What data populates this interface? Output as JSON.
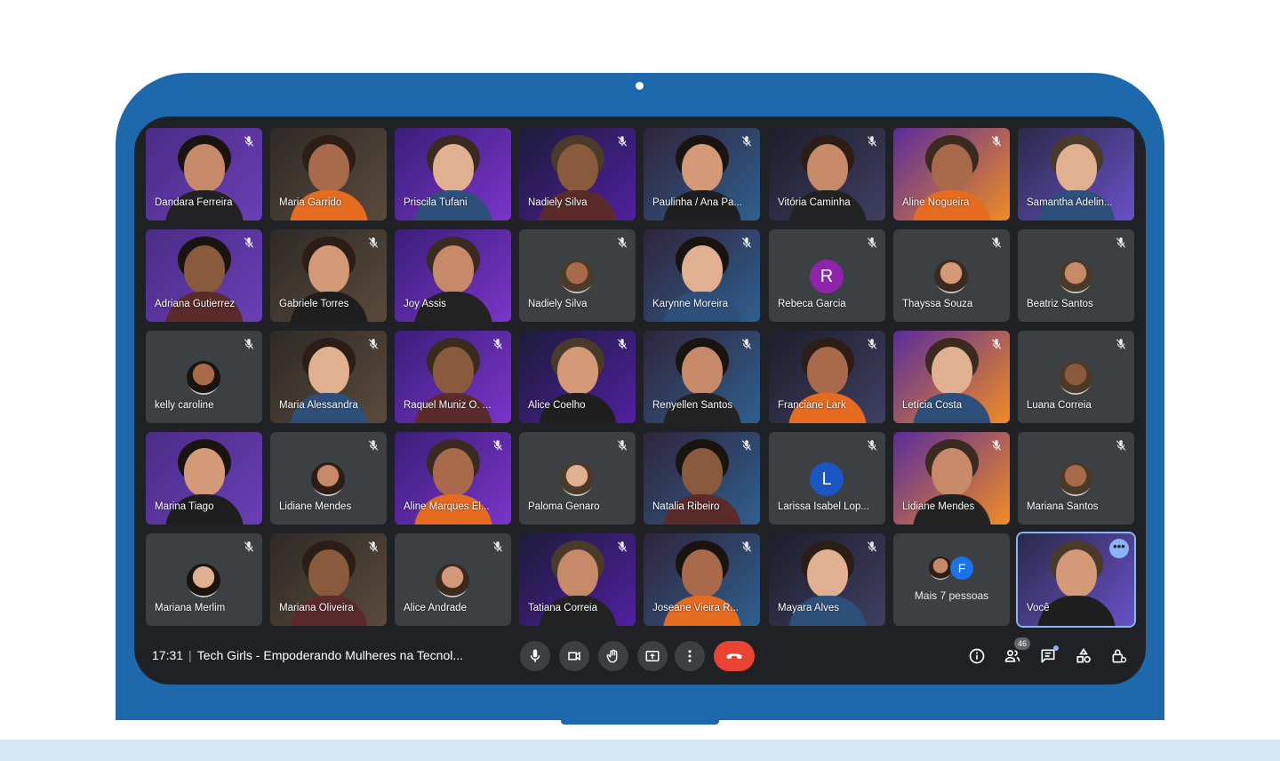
{
  "meeting": {
    "time": "17:31",
    "title": "Tech Girls - Empoderando Mulheres na Tecnol...",
    "participant_count": "46"
  },
  "participants": [
    {
      "name": "Dandara Ferreira",
      "kind": "video",
      "muted": true
    },
    {
      "name": "Maria Garrido",
      "kind": "video",
      "muted": false
    },
    {
      "name": "Priscila Tufani",
      "kind": "video",
      "muted": false
    },
    {
      "name": "Nadiely Silva",
      "kind": "video",
      "muted": true
    },
    {
      "name": "Paulinha / Ana Pa...",
      "kind": "video",
      "muted": true
    },
    {
      "name": "Vitória Caminha",
      "kind": "video",
      "muted": true
    },
    {
      "name": "Aline Nogueira",
      "kind": "video",
      "muted": true
    },
    {
      "name": "Samantha Adelin...",
      "kind": "video",
      "muted": false
    },
    {
      "name": "Adriana Gutierrez",
      "kind": "video",
      "muted": true
    },
    {
      "name": "Gabriele Torres",
      "kind": "video",
      "muted": true
    },
    {
      "name": "Joy Assis",
      "kind": "video",
      "muted": false
    },
    {
      "name": "Nadiely Silva",
      "kind": "avatar",
      "muted": true
    },
    {
      "name": "Karynne Moreira",
      "kind": "video",
      "muted": true
    },
    {
      "name": "Rebeca Garcia",
      "kind": "letter",
      "letter": "R",
      "color": "#8e24aa",
      "muted": true
    },
    {
      "name": "Thayssa Souza",
      "kind": "avatar",
      "muted": true
    },
    {
      "name": "Beatriz Santos",
      "kind": "avatar",
      "muted": true
    },
    {
      "name": "kelly caroline",
      "kind": "avatar",
      "muted": true
    },
    {
      "name": "Maria Alessandra",
      "kind": "video",
      "muted": true
    },
    {
      "name": "Raquel Muniz O. ...",
      "kind": "video",
      "muted": true
    },
    {
      "name": "Alice Coelho",
      "kind": "video",
      "muted": true
    },
    {
      "name": "Renyellen Santos",
      "kind": "video",
      "muted": true
    },
    {
      "name": "Franciane Lark",
      "kind": "video",
      "muted": true
    },
    {
      "name": "Letícia Costa",
      "kind": "video",
      "muted": true
    },
    {
      "name": "Luana Correia",
      "kind": "avatar",
      "muted": true
    },
    {
      "name": "Marina Tiago",
      "kind": "video",
      "muted": false
    },
    {
      "name": "Lidiane Mendes",
      "kind": "avatar",
      "muted": true
    },
    {
      "name": "Aline Marques El...",
      "kind": "video",
      "muted": true
    },
    {
      "name": "Paloma Genaro",
      "kind": "avatar",
      "muted": true
    },
    {
      "name": "Natalia Ribeiro",
      "kind": "video",
      "muted": true
    },
    {
      "name": "Larissa Isabel Lop...",
      "kind": "letter",
      "letter": "L",
      "color": "#1a56c4",
      "muted": true
    },
    {
      "name": "Lidiane Mendes",
      "kind": "video",
      "muted": true
    },
    {
      "name": "Mariana Santos",
      "kind": "avatar",
      "muted": true
    },
    {
      "name": "Mariana Merlim",
      "kind": "avatar",
      "muted": true
    },
    {
      "name": "Mariana Oliveira",
      "kind": "video",
      "muted": true
    },
    {
      "name": "Alice Andrade",
      "kind": "avatar",
      "muted": true
    },
    {
      "name": "Tatiana Correia",
      "kind": "video",
      "muted": true
    },
    {
      "name": "Joseane Vieira R...",
      "kind": "video",
      "muted": true
    },
    {
      "name": "Mayara Alves",
      "kind": "video",
      "muted": true
    },
    {
      "name": "Mais 7 pessoas",
      "kind": "more",
      "letter": "F",
      "muted": false
    },
    {
      "name": "Você",
      "kind": "self",
      "muted": false
    }
  ],
  "controls": {
    "mic": "mic-icon",
    "camera": "camera-icon",
    "raise_hand": "raise-hand-icon",
    "present": "present-screen-icon",
    "more": "more-options-icon",
    "leave": "end-call-icon"
  },
  "colors": {
    "laptop": "#1d69ab",
    "base": "#d6e6f4",
    "screen": "#202124",
    "tile": "#3c4043",
    "end_call": "#ea4335",
    "accent": "#8ab4f8"
  }
}
